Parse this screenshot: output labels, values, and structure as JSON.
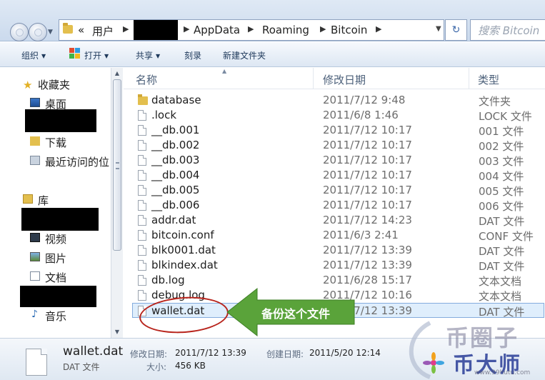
{
  "address": {
    "crumbs": [
      "«",
      "用户",
      "AppData",
      "Roaming",
      "Bitcoin"
    ],
    "search_placeholder": "搜索 Bitcoin"
  },
  "toolbar": {
    "organize": "组织",
    "open": "打开",
    "share": "共享",
    "burn": "刻录",
    "new_folder": "新建文件夹"
  },
  "nav": {
    "favorites": "收藏夹",
    "desktop": "桌面",
    "downloads": "下载",
    "recent": "最近访问的位",
    "libraries": "库",
    "videos": "视频",
    "pictures": "图片",
    "documents": "文档",
    "music": "音乐"
  },
  "columns": {
    "name": "名称",
    "modified": "修改日期",
    "type": "类型"
  },
  "files": [
    {
      "name": "database",
      "date": "2011/7/12 9:48",
      "type": "文件夹",
      "icon": "folder-icon"
    },
    {
      "name": ".lock",
      "date": "2011/6/8 1:46",
      "type": "LOCK 文件",
      "icon": "file-icon"
    },
    {
      "name": "__db.001",
      "date": "2011/7/12 10:17",
      "type": "001 文件",
      "icon": "file-icon"
    },
    {
      "name": "__db.002",
      "date": "2011/7/12 10:17",
      "type": "002 文件",
      "icon": "file-icon"
    },
    {
      "name": "__db.003",
      "date": "2011/7/12 10:17",
      "type": "003 文件",
      "icon": "file-icon"
    },
    {
      "name": "__db.004",
      "date": "2011/7/12 10:17",
      "type": "004 文件",
      "icon": "file-icon"
    },
    {
      "name": "__db.005",
      "date": "2011/7/12 10:17",
      "type": "005 文件",
      "icon": "file-icon"
    },
    {
      "name": "__db.006",
      "date": "2011/7/12 10:17",
      "type": "006 文件",
      "icon": "file-icon"
    },
    {
      "name": "addr.dat",
      "date": "2011/7/12 14:23",
      "type": "DAT 文件",
      "icon": "file-icon"
    },
    {
      "name": "bitcoin.conf",
      "date": "2011/6/3 2:41",
      "type": "CONF 文件",
      "icon": "file-icon"
    },
    {
      "name": "blk0001.dat",
      "date": "2011/7/12 13:39",
      "type": "DAT 文件",
      "icon": "file-icon"
    },
    {
      "name": "blkindex.dat",
      "date": "2011/7/12 13:39",
      "type": "DAT 文件",
      "icon": "file-icon"
    },
    {
      "name": "db.log",
      "date": "2011/6/28 15:17",
      "type": "文本文档",
      "icon": "file-icon"
    },
    {
      "name": "debug.log",
      "date": "2011/7/12 10:16",
      "type": "文本文档",
      "icon": "file-icon"
    },
    {
      "name": "wallet.dat",
      "date": "2011/7/12 13:39",
      "type": "DAT 文件",
      "icon": "file-icon"
    }
  ],
  "selected_index": 14,
  "annotation": {
    "text": "备份这个文件",
    "arrow_color": "#5aa33a",
    "circle_color": "#b8241c"
  },
  "details": {
    "name": "wallet.dat",
    "type": "DAT 文件",
    "modified_label": "修改日期:",
    "modified_value": "2011/7/12 13:39",
    "created_label": "创建日期:",
    "created_value": "2011/5/20 12:14",
    "size_label": "大小:",
    "size_value": "456 KB"
  },
  "watermark": {
    "line1": "币圈子",
    "line2": "币大师",
    "url": "www.99hutu.com"
  }
}
